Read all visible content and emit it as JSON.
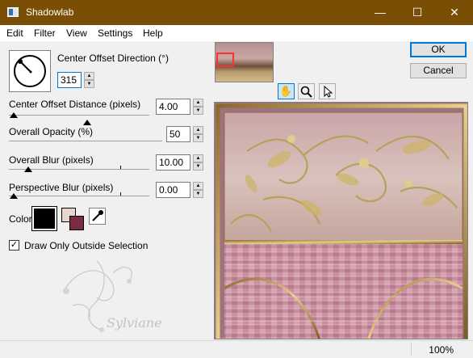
{
  "window": {
    "title": "Shadowlab",
    "minimize_glyph": "—",
    "maximize_glyph": "☐",
    "close_glyph": "✕"
  },
  "menu": [
    "Edit",
    "Filter",
    "View",
    "Settings",
    "Help"
  ],
  "controls": {
    "direction": {
      "label": "Center Offset Direction (°)",
      "value": "315"
    },
    "distance": {
      "label": "Center Offset Distance (pixels)",
      "value": "4.00"
    },
    "opacity": {
      "label": "Overall Opacity (%)",
      "value": "50"
    },
    "blur": {
      "label": "Overall Blur (pixels)",
      "value": "10.00"
    },
    "perspective": {
      "label": "Perspective Blur (pixels)",
      "value": "0.00"
    }
  },
  "color": {
    "label": "Color",
    "shadow_color": "#000000",
    "background_swatch": "#e6d6cc",
    "foreground_swatch": "#7a2d42"
  },
  "draw_outside": {
    "label": "Draw Only Outside Selection",
    "checked": true
  },
  "buttons": {
    "ok": "OK",
    "cancel": "Cancel"
  },
  "tools": [
    "hand-icon",
    "zoom-icon",
    "arrow-icon"
  ],
  "watermark_text": "Sylviane",
  "status": {
    "zoom": "100%"
  },
  "colors": {
    "titlebar": "#7a4f05",
    "frame_gold": "#c9a84f",
    "preview_pink": "#b98a92"
  }
}
